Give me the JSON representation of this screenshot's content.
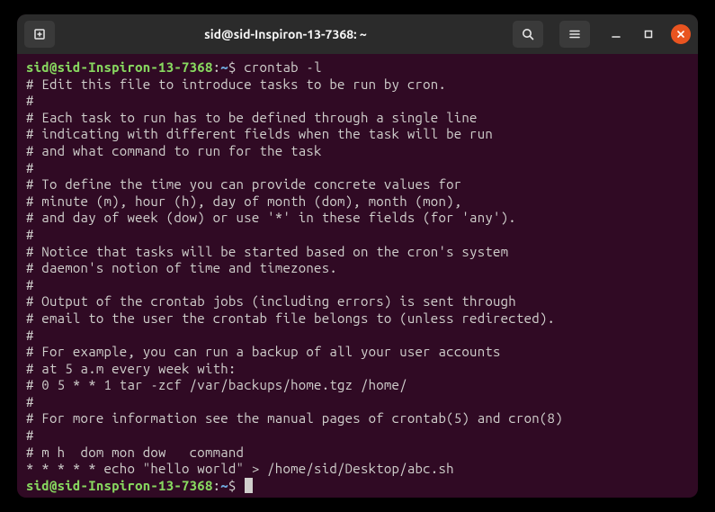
{
  "titlebar": {
    "title": "sid@sid-Inspiron-13-7368: ~"
  },
  "prompt": {
    "userhost": "sid@sid-Inspiron-13-7368",
    "sep": ":",
    "path": "~",
    "dollar": "$"
  },
  "commands": {
    "first": "crontab -l",
    "second": ""
  },
  "output": [
    "# Edit this file to introduce tasks to be run by cron.",
    "#",
    "# Each task to run has to be defined through a single line",
    "# indicating with different fields when the task will be run",
    "# and what command to run for the task",
    "#",
    "# To define the time you can provide concrete values for",
    "# minute (m), hour (h), day of month (dom), month (mon),",
    "# and day of week (dow) or use '*' in these fields (for 'any').",
    "#",
    "# Notice that tasks will be started based on the cron's system",
    "# daemon's notion of time and timezones.",
    "#",
    "# Output of the crontab jobs (including errors) is sent through",
    "# email to the user the crontab file belongs to (unless redirected).",
    "#",
    "# For example, you can run a backup of all your user accounts",
    "# at 5 a.m every week with:",
    "# 0 5 * * 1 tar -zcf /var/backups/home.tgz /home/",
    "#",
    "# For more information see the manual pages of crontab(5) and cron(8)",
    "#",
    "# m h  dom mon dow   command",
    "* * * * * echo \"hello world\" > /home/sid/Desktop/abc.sh"
  ]
}
